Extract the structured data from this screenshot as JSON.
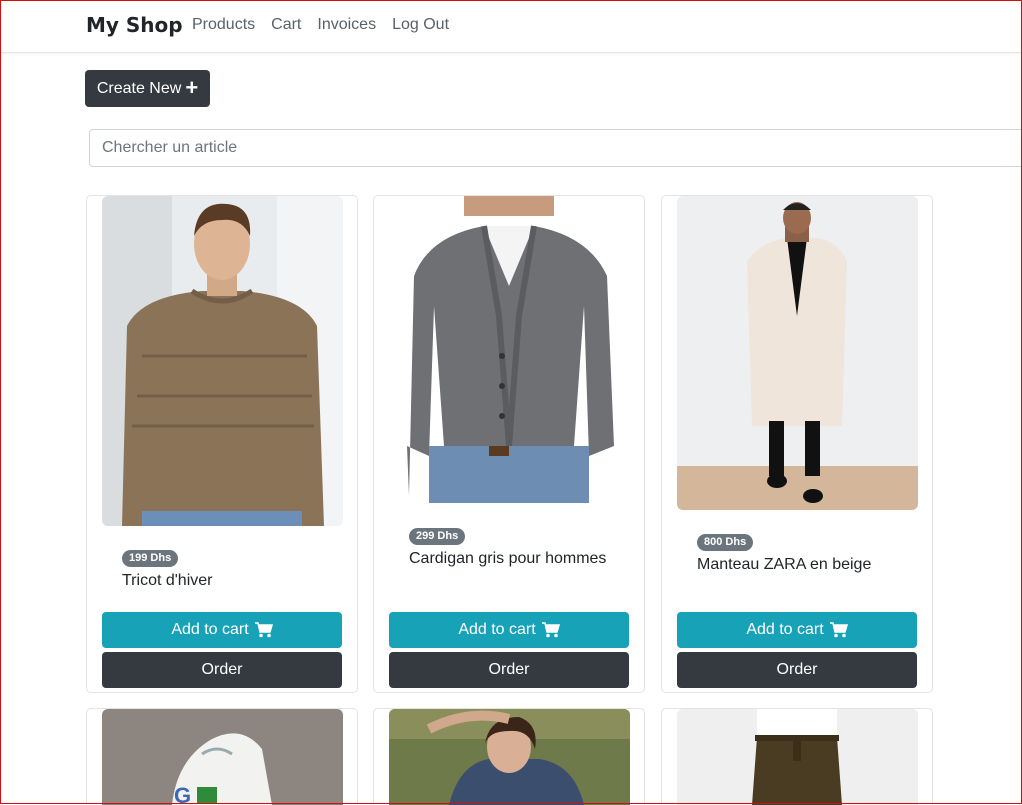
{
  "navbar": {
    "brand": "My Shop",
    "links": [
      "Products",
      "Cart",
      "Invoices",
      "Log Out"
    ]
  },
  "toolbar": {
    "create_label": "Create New",
    "create_icon": "plus-icon"
  },
  "search": {
    "placeholder": "Chercher un article",
    "value": ""
  },
  "products": [
    {
      "name": "Tricot d'hiver",
      "price": "199 Dhs",
      "image": "brown-sweater-photo"
    },
    {
      "name": "Cardigan gris pour hommes",
      "price": "299 Dhs",
      "image": "grey-cardigan-photo"
    },
    {
      "name": "Manteau ZARA en beige",
      "price": "800 Dhs",
      "image": "beige-coat-photo"
    },
    {
      "name": "",
      "price": "",
      "image": "sneaker-photo"
    },
    {
      "name": "",
      "price": "",
      "image": "woman-denim-jacket-photo"
    },
    {
      "name": "",
      "price": "",
      "image": "olive-trousers-photo"
    }
  ],
  "card_actions": {
    "add_to_cart_label": "Add to cart",
    "order_label": "Order",
    "cart_icon": "shopping-cart-icon"
  },
  "colors": {
    "primary_dark": "#343a40",
    "info": "#17a2b8",
    "badge": "#6c757d"
  }
}
